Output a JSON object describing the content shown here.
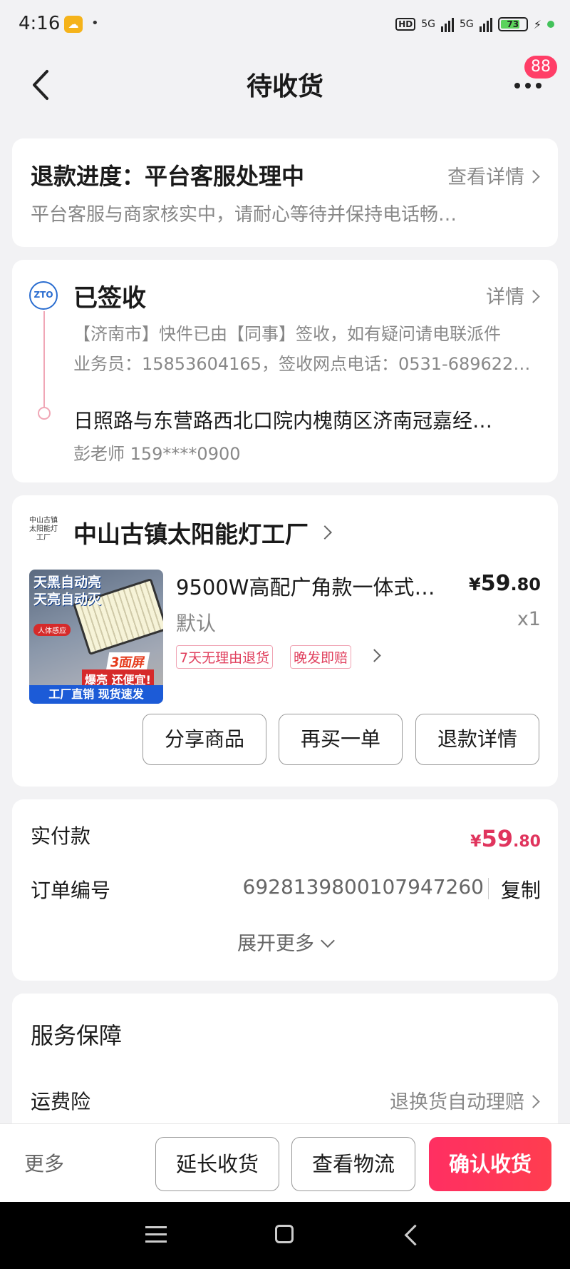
{
  "status_bar": {
    "time": "4:16",
    "network_1": "5G",
    "network_2": "5G",
    "battery": "73",
    "hd": "HD"
  },
  "nav": {
    "title": "待收货",
    "badge": "88"
  },
  "refund": {
    "title": "退款进度：平台客服处理中",
    "link": "查看详情",
    "desc": "平台客服与商家核实中，请耐心等待并保持电话畅…"
  },
  "logistics": {
    "carrier_logo": "ZTO",
    "status": "已签收",
    "link": "详情",
    "detail_1": "【济南市】快件已由【同事】签收，如有疑问请电联派件",
    "detail_2": "业务员：15853604165，签收网点电话：0531-689622…",
    "address": "日照路与东营路西北口院内槐荫区济南冠嘉经…",
    "contact": "彭老师 159****0900"
  },
  "shop": {
    "name": "中山古镇太阳能灯工厂",
    "logo_text": "中山古镇太阳能灯工厂"
  },
  "product": {
    "title": "9500W高配广角款一体式…",
    "price_currency": "¥",
    "price_int": "59",
    "price_dec": ".80",
    "variant": "默认",
    "qty": "x1",
    "tags": [
      "7天无理由退货",
      "晚发即赔"
    ],
    "image_text": {
      "top": "天黑自动亮\n天亮自动灭",
      "tag": "人体感应",
      "screen": "3面屏",
      "promo": "爆亮 还便宜!",
      "bottom": "工厂直销  现货速发"
    },
    "buttons": {
      "share": "分享商品",
      "rebuy": "再买一单",
      "refund": "退款详情"
    }
  },
  "payment": {
    "paid_label": "实付款",
    "paid_currency": "¥",
    "paid_int": "59",
    "paid_dec": ".80",
    "order_label": "订单编号",
    "order_no": "6928139800107947260",
    "copy": "复制",
    "expand": "展开更多"
  },
  "service": {
    "title": "服务保障",
    "item_label": "运费险",
    "item_value": "退换货自动理赔"
  },
  "bottom_bar": {
    "more": "更多",
    "extend": "延长收货",
    "logistics": "查看物流",
    "confirm": "确认收货"
  },
  "colors": {
    "accent": "#ff2f62",
    "price": "#e0345d",
    "background": "#f2f2f4"
  }
}
